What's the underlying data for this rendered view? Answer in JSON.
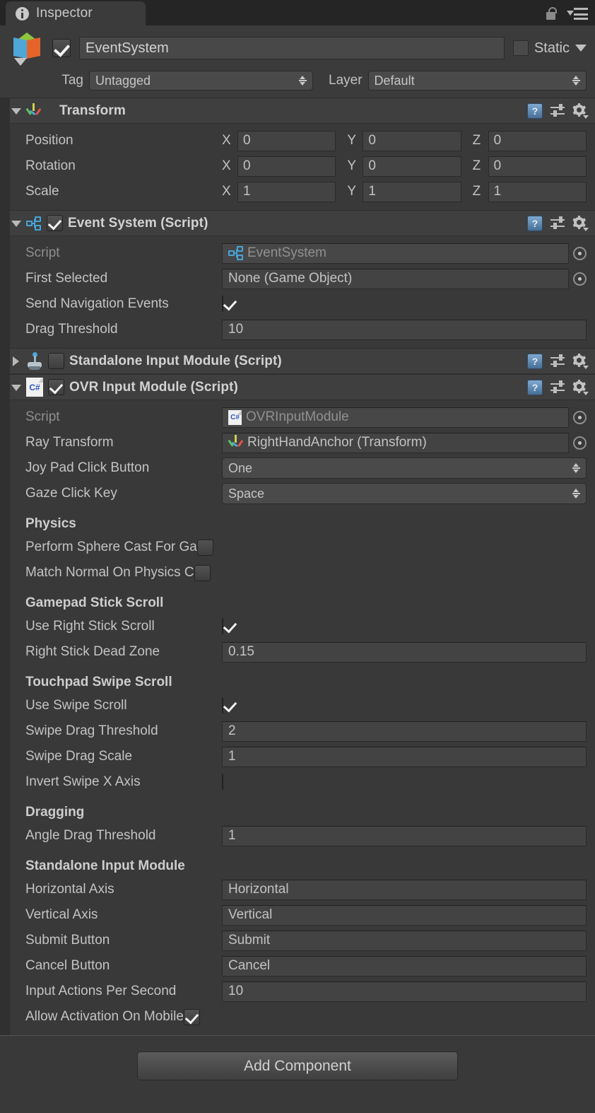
{
  "window": {
    "tab_label": "Inspector",
    "info_icon": "info-icon",
    "lock_icon": "lock-icon",
    "menu_icon": "hamburger-menu-icon"
  },
  "gameobject": {
    "icon": "cube-prefab-icon",
    "enabled": true,
    "name": "EventSystem",
    "static_label": "Static",
    "static_checked": false,
    "tag_label": "Tag",
    "tag_value": "Untagged",
    "layer_label": "Layer",
    "layer_value": "Default"
  },
  "components": [
    {
      "title": "Transform",
      "icon": "transform-axis-icon",
      "expanded": true,
      "has_enable_checkbox": false,
      "rows": [
        {
          "label": "Position",
          "type": "vector3",
          "x": "0",
          "y": "0",
          "z": "0"
        },
        {
          "label": "Rotation",
          "type": "vector3",
          "x": "0",
          "y": "0",
          "z": "0"
        },
        {
          "label": "Scale",
          "type": "vector3",
          "x": "1",
          "y": "1",
          "z": "1"
        }
      ]
    },
    {
      "title": "Event System (Script)",
      "icon": "script-tree-icon",
      "expanded": true,
      "has_enable_checkbox": true,
      "enabled": true,
      "rows": [
        {
          "label": "Script",
          "type": "object",
          "value": "EventSystem",
          "dim": true,
          "icon": "script-tree-icon"
        },
        {
          "label": "First Selected",
          "type": "object",
          "value": "None (Game Object)"
        },
        {
          "label": "Send Navigation Events",
          "type": "toggle",
          "checked": true
        },
        {
          "label": "Drag Threshold",
          "type": "text",
          "value": "10"
        }
      ]
    },
    {
      "title": "Standalone Input Module (Script)",
      "icon": "joystick-icon",
      "expanded": false,
      "has_enable_checkbox": true,
      "enabled": false,
      "rows": []
    },
    {
      "title": "OVR Input Module (Script)",
      "icon": "csharp-script-icon",
      "expanded": true,
      "has_enable_checkbox": true,
      "enabled": true,
      "rows": [
        {
          "label": "Script",
          "type": "object",
          "value": "OVRInputModule",
          "dim": true,
          "icon": "csharp-script-icon"
        },
        {
          "label": "Ray Transform",
          "type": "object",
          "value": "RightHandAnchor (Transform)",
          "icon": "transform-axis-icon"
        },
        {
          "label": "Joy Pad Click Button",
          "type": "popup",
          "value": "One"
        },
        {
          "label": "Gaze Click Key",
          "type": "popup",
          "value": "Space"
        },
        {
          "label": "Physics",
          "type": "header"
        },
        {
          "label": "Perform Sphere Cast For Ga",
          "type": "toggle-narrow",
          "checked": false
        },
        {
          "label": "Match Normal On Physics C",
          "type": "toggle-narrow",
          "checked": false
        },
        {
          "label": "Gamepad Stick Scroll",
          "type": "header"
        },
        {
          "label": "Use Right Stick Scroll",
          "type": "toggle",
          "checked": true
        },
        {
          "label": "Right Stick Dead Zone",
          "type": "text",
          "value": "0.15"
        },
        {
          "label": "Touchpad Swipe Scroll",
          "type": "header"
        },
        {
          "label": "Use Swipe Scroll",
          "type": "toggle",
          "checked": true
        },
        {
          "label": "Swipe Drag Threshold",
          "type": "text",
          "value": "2"
        },
        {
          "label": "Swipe Drag Scale",
          "type": "text",
          "value": "1"
        },
        {
          "label": "Invert Swipe X Axis",
          "type": "toggle",
          "checked": false
        },
        {
          "label": "Dragging",
          "type": "header"
        },
        {
          "label": "Angle Drag Threshold",
          "type": "text",
          "value": "1"
        },
        {
          "label": "Standalone Input Module",
          "type": "header"
        },
        {
          "label": "Horizontal Axis",
          "type": "text",
          "value": "Horizontal"
        },
        {
          "label": "Vertical Axis",
          "type": "text",
          "value": "Vertical"
        },
        {
          "label": "Submit Button",
          "type": "text",
          "value": "Submit"
        },
        {
          "label": "Cancel Button",
          "type": "text",
          "value": "Cancel"
        },
        {
          "label": "Input Actions Per Second",
          "type": "text",
          "value": "10"
        },
        {
          "label": "Allow Activation On Mobile",
          "type": "toggle-narrow",
          "checked": true
        }
      ]
    }
  ],
  "footer": {
    "add_component_label": "Add Component"
  },
  "colors": {
    "panel_bg": "#393939",
    "header_bg": "#3f3f3f",
    "tabbar_bg": "#252525",
    "field_bg": "#434343",
    "text": "#c3c3c3",
    "accent_blue": "#45a3d8",
    "cube_green": "#8cc63e",
    "cube_blue": "#4fa7d8",
    "cube_orange": "#e5642a"
  }
}
